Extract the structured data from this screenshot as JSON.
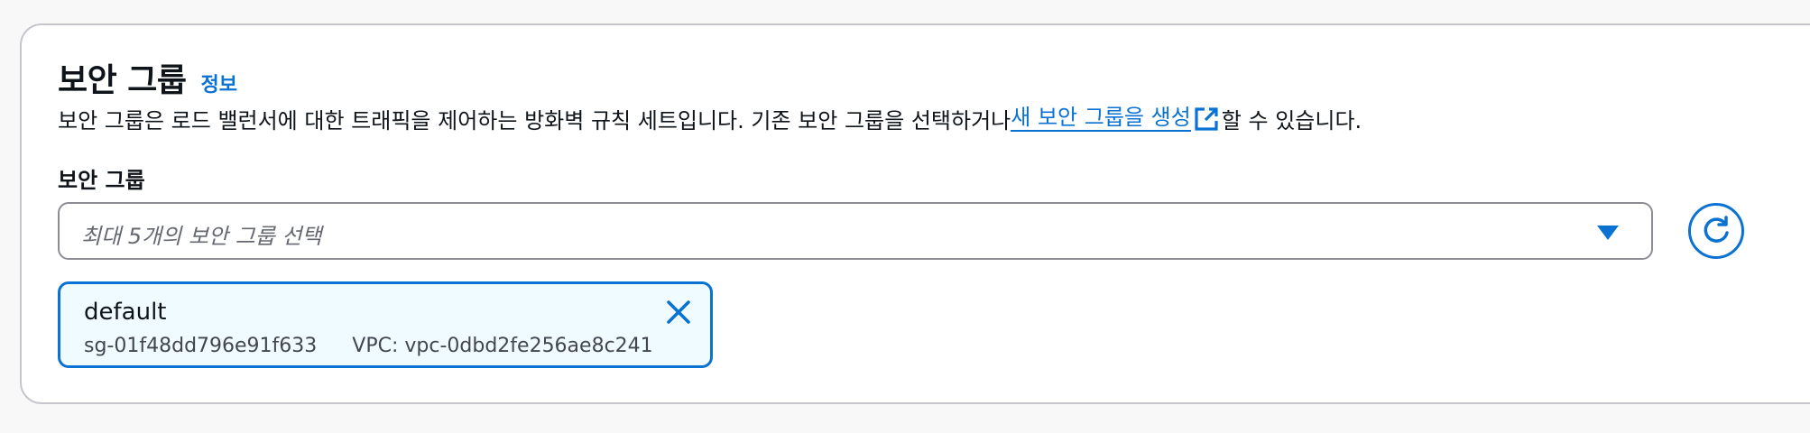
{
  "section": {
    "title": "보안 그룹",
    "info_label": "정보",
    "description_prefix": "보안 그룹은 로드 밸런서에 대한 트래픽을 제어하는 방화벽 규칙 세트입니다. 기존 보안 그룹을 선택하거나 ",
    "create_link_label": "새 보안 그룹을 생성",
    "description_suffix": "할 수 있습니다."
  },
  "field": {
    "label": "보안 그룹",
    "placeholder": "최대 5개의 보안 그룹 선택"
  },
  "selected_groups": [
    {
      "name": "default",
      "id": "sg-01f48dd796e91f633",
      "vpc": "VPC: vpc-0dbd2fe256ae8c241"
    }
  ],
  "icons": {
    "external_link": "external-link-icon",
    "dropdown": "caret-down-icon",
    "refresh": "refresh-icon",
    "dismiss": "close-icon"
  },
  "colors": {
    "accent": "#0972d3",
    "token_background": "#f0fbff",
    "text": "#0f141a",
    "muted_text": "#656871"
  }
}
